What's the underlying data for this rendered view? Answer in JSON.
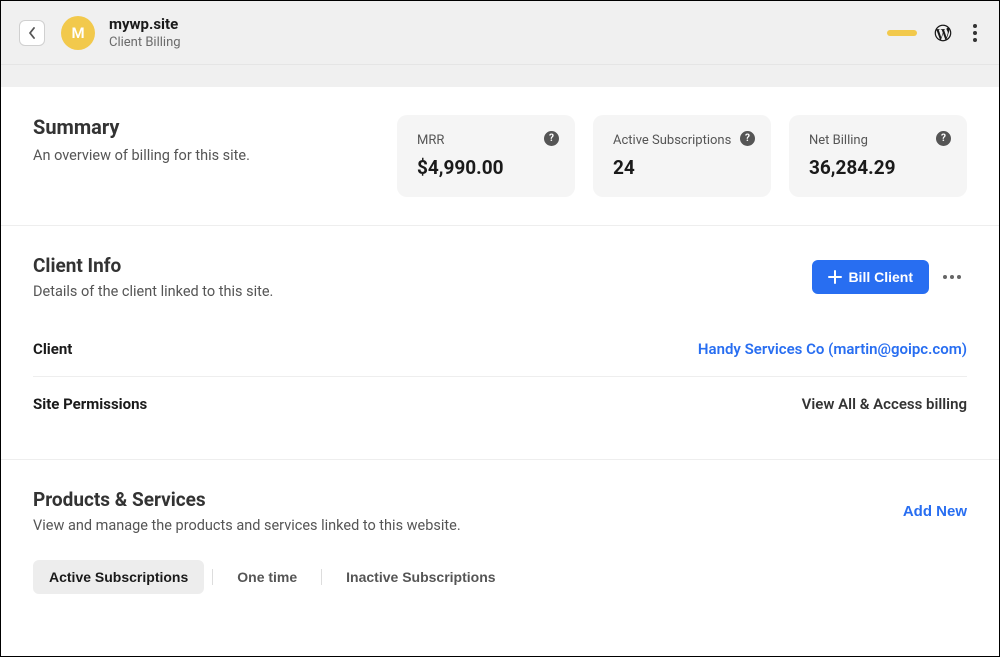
{
  "header": {
    "avatar_letter": "M",
    "site_name": "mywp.site",
    "subtitle": "Client Billing"
  },
  "summary": {
    "title": "Summary",
    "subtitle": "An overview of billing for this site.",
    "cards": [
      {
        "label": "MRR",
        "value": "$4,990.00"
      },
      {
        "label": "Active Subscriptions",
        "value": "24"
      },
      {
        "label": "Net Billing",
        "value": "36,284.29"
      }
    ]
  },
  "client_info": {
    "title": "Client Info",
    "subtitle": "Details of the client linked to this site.",
    "bill_button": "Bill Client",
    "rows": {
      "client_label": "Client",
      "client_value": "Handy Services Co (martin@goipc.com)",
      "perm_label": "Site Permissions",
      "perm_value": "View All & Access billing"
    }
  },
  "products": {
    "title": "Products & Services",
    "subtitle": "View and manage the products and services linked to this website.",
    "add_new": "Add New",
    "tabs": {
      "active": "Active Subscriptions",
      "onetime": "One time",
      "inactive": "Inactive Subscriptions"
    }
  }
}
